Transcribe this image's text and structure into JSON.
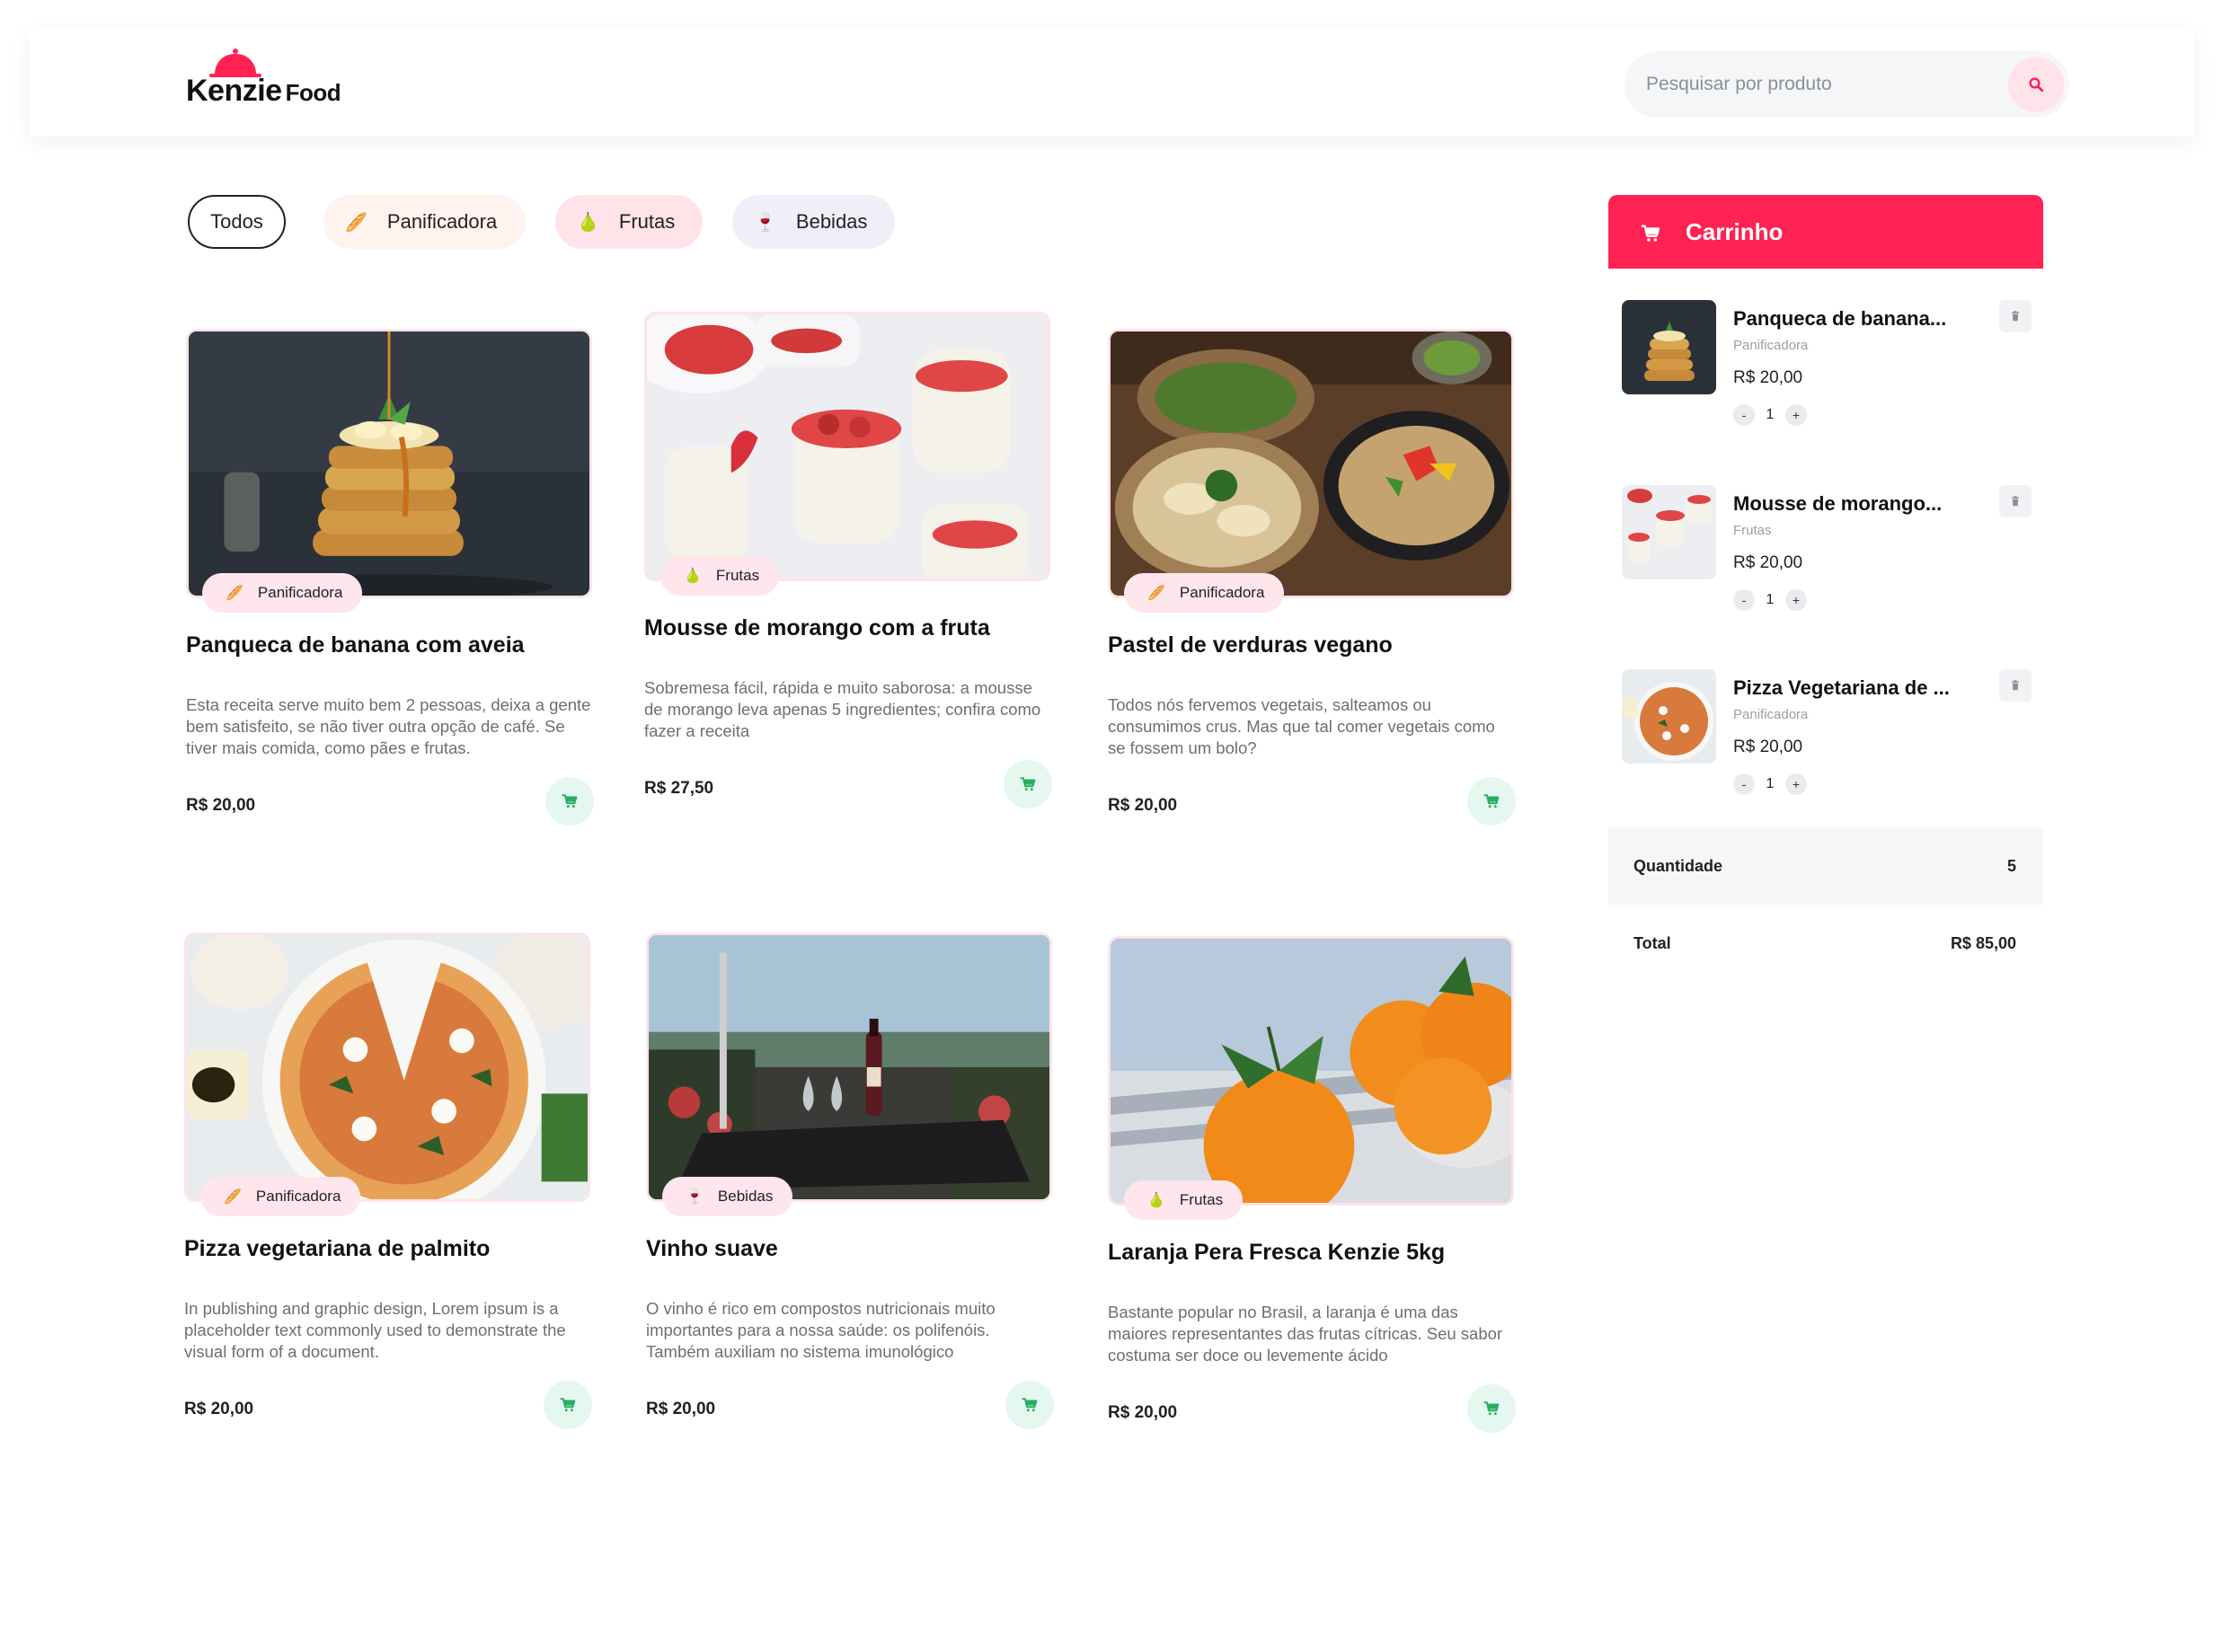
{
  "header": {
    "logo_main": "Kenzie",
    "logo_sub": "Food",
    "search_placeholder": "Pesquisar por produto"
  },
  "filters": [
    {
      "label": "Todos",
      "active": true
    },
    {
      "label": "Panificadora",
      "emoji": "🥖"
    },
    {
      "label": "Frutas",
      "emoji": "🍐"
    },
    {
      "label": "Bebidas",
      "emoji": "🍷"
    }
  ],
  "products": [
    {
      "category": "Panificadora",
      "emoji": "🥖",
      "title": "Panqueca de banana com aveia",
      "description": "Esta receita serve muito bem 2 pessoas, deixa a gente bem satisfeito, se não tiver outra opção de café. Se tiver mais comida, como pães e frutas.",
      "price": "R$ 20,00",
      "image": "pancake-photo"
    },
    {
      "category": "Frutas",
      "emoji": "🍐",
      "title": "Mousse de morango com a fruta",
      "description": "Sobremesa fácil, rápida e muito saborosa: a mousse de morango leva apenas 5 ingredientes; confira como fazer a receita",
      "price": "R$ 27,50",
      "image": "mousse-photo"
    },
    {
      "category": "Panificadora",
      "emoji": "🥖",
      "title": "Pastel de verduras vegano",
      "description": "Todos nós fervemos vegetais, salteamos ou consumimos crus. Mas que tal comer vegetais como se fossem um bolo?",
      "price": "R$ 20,00",
      "image": "dumplings-photo"
    },
    {
      "category": "Panificadora",
      "emoji": "🥖",
      "title": "Pizza vegetariana de palmito",
      "description": "In publishing and graphic design, Lorem ipsum is a placeholder text commonly used to demonstrate the visual form of a document.",
      "price": "R$ 20,00",
      "image": "pizza-photo"
    },
    {
      "category": "Bebidas",
      "emoji": "🍷",
      "title": "Vinho suave",
      "description": "O vinho é rico em compostos nutricionais muito importantes para a nossa saúde: os polifenóis. Também auxiliam no sistema imunológico",
      "price": "R$ 20,00",
      "image": "wine-photo"
    },
    {
      "category": "Frutas",
      "emoji": "🍐",
      "title": "Laranja Pera Fresca Kenzie 5kg",
      "description": "Bastante popular no Brasil, a laranja é uma das maiores representantes das frutas cítricas. Seu sabor costuma ser doce ou levemente ácido",
      "price": "R$ 20,00",
      "image": "orange-photo"
    }
  ],
  "cart": {
    "title": "Carrinho",
    "items": [
      {
        "name": "Panqueca de banana...",
        "category": "Panificadora",
        "price": "R$ 20,00",
        "qty": "1",
        "minus": "-",
        "plus": "+"
      },
      {
        "name": "Mousse de morango...",
        "category": "Frutas",
        "price": "R$ 20,00",
        "qty": "1",
        "minus": "-",
        "plus": "+"
      },
      {
        "name": "Pizza Vegetariana de ...",
        "category": "Panificadora",
        "price": "R$ 20,00",
        "qty": "1",
        "minus": "-",
        "plus": "+"
      }
    ],
    "quantity_label": "Quantidade",
    "quantity_value": "5",
    "total_label": "Total",
    "total_value": "R$ 85,00"
  },
  "colors": {
    "accent": "#ff2253",
    "add_button": "#e4f8ef",
    "add_icon": "#27ae60"
  },
  "icons": {
    "search": "search-icon",
    "cart": "cart-icon",
    "add_to_cart": "cart-icon",
    "delete": "trash-icon"
  }
}
